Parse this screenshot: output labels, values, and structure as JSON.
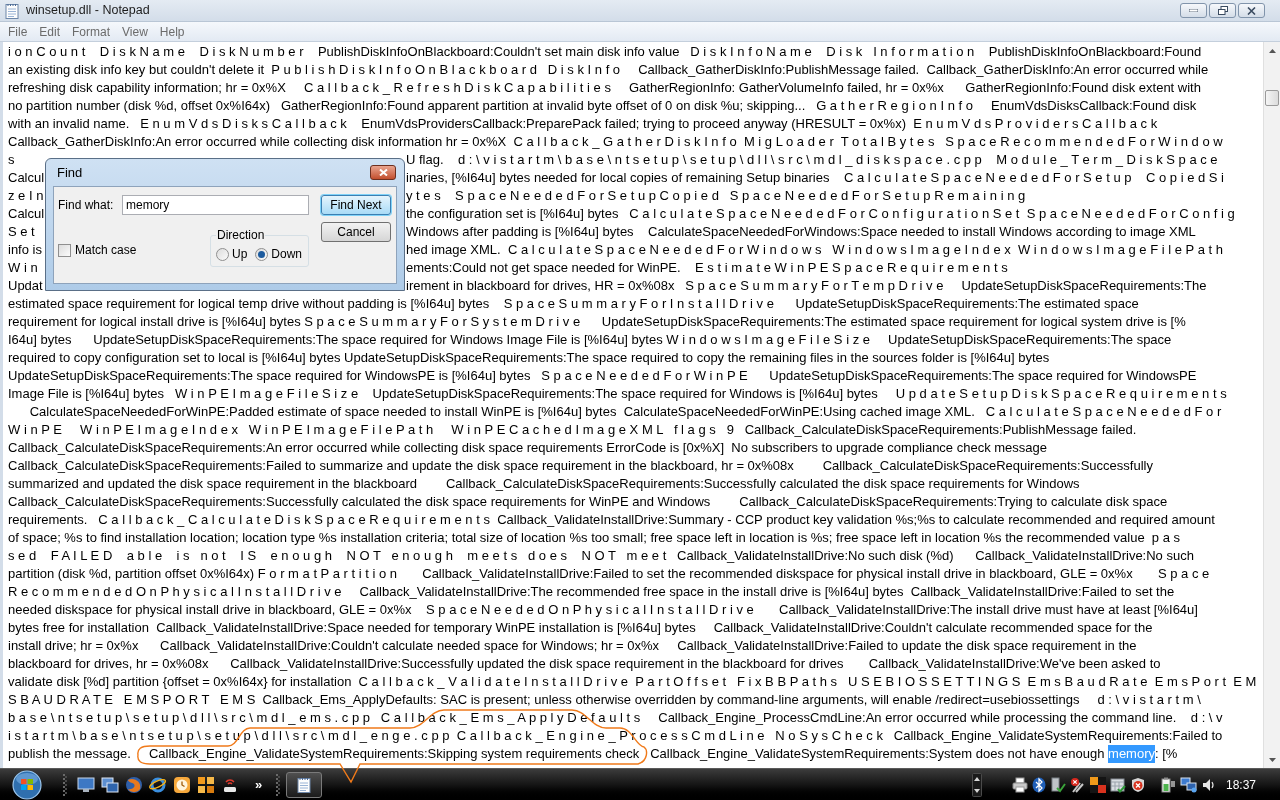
{
  "window": {
    "title": "winsetup.dll - Notepad",
    "menu": [
      "File",
      "Edit",
      "Format",
      "View",
      "Help"
    ]
  },
  "document": {
    "lines": [
      {
        "kind": "full",
        "text": "i o n C o u n t    D i s k N a m e    D i s k N u m b e r    PublishDiskInfoOnBlackboard:Couldn't set main disk info value   D i s k I n f o N a m e    D i s k   I n f o r m a t i o n    PublishDiskInfoOnBlackboard:Found"
      },
      {
        "kind": "full",
        "text": "an existing disk info key but couldn't delete it  P u b l i s h D i s k I n f o O n B l a c k b o a r d   D i s k I n f o     Callback_GatherDiskInfo:PublishMessage failed.  Callback_GatherDiskInfo:An error occurred while"
      },
      {
        "kind": "full",
        "text": "refreshing disk capability information; hr = 0x%X     C a l l b a c k _ R e f r e s h D i s k C a p a b i l i t i e s     GatherRegionInfo: GatherVolumeInfo failed, hr = 0x%x      GatherRegionInfo:Found disk extent with"
      },
      {
        "kind": "full",
        "text": "no partition number (disk %d, offset 0x%I64x)   GatherRegionInfo:Found apparent partition at invalid byte offset of 0 on disk %u; skipping...   G a t h e r R e g i o n I n f o     EnumVdsDisksCallback:Found disk"
      },
      {
        "kind": "full",
        "text": "with an invalid name.   E n u m V d s D i s k s C a l l b a c k    EnumVdsProvidersCallback:PreparePack failed; trying to proceed anyway (HRESULT = 0x%x)  E n u m V d s P r o v i d e r s C a l l b a c k"
      },
      {
        "kind": "full",
        "text": "Callback_GatherDiskInfo:An error occurred while collecting disk information hr = 0x%X  C a l l b a c k _ G a t h e r D i s k I n f o  M i g L o a d e r  T o t a l B y t e s   S p a c e R e c o m m e n d e d F o r W i n d o w"
      },
      {
        "kind": "split",
        "left": "s",
        "right": "U flag.    d : \\ v i s t a r t m \\ b a s e \\ n t s e t u p \\ s e t u p \\ d l l \\ s r c \\ m d l _ d i s k s p a c e . c p p    M o d u l e _ T e r m _ D i s k S p a c e"
      },
      {
        "kind": "split",
        "left": "Calcul",
        "right": "inaries, [%I64u] bytes needed for local copies of remaining Setup binaries    C a l c u l a t e S p a c e N e e d e d F o r S e t u p    C o p i e d S i"
      },
      {
        "kind": "split",
        "left": "z e I n",
        "right": "y t e s    S p a c e N e e d e d F o r S e t u p C o p i e d   S p a c e N e e d e d F o r S e t u p R e m a i n i n g"
      },
      {
        "kind": "split",
        "left": "Calcul",
        "right": "the configuration set is [%I64u] bytes   C a l c u l a t e S p a c e N e e d e d F o r C o n f i g u r a t i o n S e t  S p a c e N e e d e d F o r C o n f i g"
      },
      {
        "kind": "split",
        "left": "S e t",
        "right": "Windows after padding is [%I64u] bytes    CalculateSpaceNeededForWindows:Space needed to install Windows according to image XML"
      },
      {
        "kind": "split",
        "left": "info is",
        "right": "hed image XML.  C a l c u l a t e S p a c e N e e d e d F o r W i n d o w s   W i n d o w s I m a g e I n d e x  W i n d o w s I m a g e F i l e P a t h"
      },
      {
        "kind": "split",
        "left": "W i n",
        "right": "ements:Could not get space needed for WinPE.    E s t i m a t e W i n P E S p a c e R e q u i r e m e n t s"
      },
      {
        "kind": "split",
        "left": "Updat",
        "right": "irement in blackboard for drives, HR = 0x%08x   S p a c e S u m m a r y F o r T e m p D r i v e     UpdateSetupDiskSpaceRequirements:The"
      },
      {
        "kind": "full",
        "text": "estimated space requirement for logical temp drive without padding is [%I64u] bytes    S p a c e S u m m a r y F o r I n s t a l l D r i v e      UpdateSetupDiskSpaceRequirements:The estimated space"
      },
      {
        "kind": "full",
        "text": "requirement for logical install drive is [%I64u] bytes S p a c e S u m m a r y F o r S y s t e m D r i v e      UpdateSetupDiskSpaceRequirements:The estimated space requirement for logical system drive is [%"
      },
      {
        "kind": "full",
        "text": "I64u] bytes      UpdateSetupDiskSpaceRequirements:The space required for Windows Image File is [%I64u] bytes W i n d o w s I m a g e F i l e S i z e     UpdateSetupDiskSpaceRequirements:The space"
      },
      {
        "kind": "full",
        "text": "required to copy configuration set to local is [%I64u] bytes UpdateSetupDiskSpaceRequirements:The space required to copy the remaining files in the sources folder is [%I64u] bytes"
      },
      {
        "kind": "full",
        "text": "UpdateSetupDiskSpaceRequirements:The space required for WindowsPE is [%I64u] bytes   S p a c e N e e d e d F o r W i n P E      UpdateSetupDiskSpaceRequirements:The space required for WindowsPE"
      },
      {
        "kind": "full",
        "text": "Image File is [%I64u] bytes   W i n P E I m a g e F i l e S i z e    UpdateSetupDiskSpaceRequirements:The space required for Windows is [%I64u] bytes     U p d a t e S e t u p D i s k S p a c e R e q u i r e m e n t s"
      },
      {
        "kind": "full",
        "text": "      CalculateSpaceNeededForWinPE:Padded estimate of space needed to install WinPE is [%I64u] bytes  CalculateSpaceNeededForWinPE:Using cached image XML.   C a l c u l a t e S p a c e N e e d e d F o r"
      },
      {
        "kind": "full",
        "text": "W i n P E     W i n P E I m a g e I n d e x   W i n P E I m a g e F i l e P a t h     W i n P E C a c h e d I m a g e X M L   f l a g s   9   Callback_CalculateDiskSpaceRequirements:PublishMessage failed."
      },
      {
        "kind": "full",
        "text": "Callback_CalculateDiskSpaceRequirements:An error occurred while collecting disk space requirements ErrorCode is [0x%X]  No subscribers to upgrade compliance check message"
      },
      {
        "kind": "full",
        "text": "Callback_CalculateDiskSpaceRequirements:Failed to summarize and update the disk space requirement in the blackboard, hr = 0x%08x        Callback_CalculateDiskSpaceRequirements:Successfully"
      },
      {
        "kind": "full",
        "text": "summarized and updated the disk space requirement in the blackboard        Callback_CalculateDiskSpaceRequirements:Successfully calculated the disk space requirements for Windows"
      },
      {
        "kind": "full",
        "text": "Callback_CalculateDiskSpaceRequirements:Successfully calculated the disk space requirements for WinPE and Windows        Callback_CalculateDiskSpaceRequirements:Trying to calculate disk space"
      },
      {
        "kind": "full",
        "text": "requirements.   C a l l b a c k _ C a l c u l a t e D i s k S p a c e R e q u i r e m e n t s  Callback_ValidateInstallDrive:Summary - CCP product key validation %s;%s to calculate recommended and required amount"
      },
      {
        "kind": "full",
        "text": "of space; %s to find installation location; location type %s installation criteria; total size of location %s too small; free space left in location is %s; free space left in location %s the recommended value  p a s"
      },
      {
        "kind": "full",
        "text": "s e d    F A I L E D    a b l e    i s   n o t    I S    e n o u g h    N O T   e n o u g h    m e e t s   d o e s    N O T   m e e t   Callback_ValidateInstallDrive:No such disk (%d)      Callback_ValidateInstallDrive:No such"
      },
      {
        "kind": "full",
        "text": "partition (disk %d, partition offset 0x%I64x) F o r m a t P a r t i t i o n       Callback_ValidateInstallDrive:Failed to set the recommended diskspace for physical install drive in blackboard, GLE = 0x%x       S p a c e"
      },
      {
        "kind": "full",
        "text": "R e c o m m e n d e d O n P h y s i c a l I n s t a l l D r i v e     Callback_ValidateInstallDrive:The recommended free space in the install drive is [%I64u] bytes  Callback_ValidateInstallDrive:Failed to set the"
      },
      {
        "kind": "full",
        "text": "needed diskspace for physical install drive in blackboard, GLE = 0x%x    S p a c e N e e d e d O n P h y s i c a l I n s t a l l D r i v e       Callback_ValidateInstallDrive:The install drive must have at least [%I64u]"
      },
      {
        "kind": "full",
        "text": "bytes free for installation  Callback_ValidateInstallDrive:Space needed for temporary WinPE installation is [%I64u] bytes     Callback_ValidateInstallDrive:Couldn't calculate recommended space for the"
      },
      {
        "kind": "full",
        "text": "install drive; hr = 0x%x      Callback_ValidateInstallDrive:Couldn't calculate needed space for Windows; hr = 0x%x     Callback_ValidateInstallDrive:Failed to update the disk space requirement in the"
      },
      {
        "kind": "full",
        "text": "blackboard for drives, hr = 0x%08x      Callback_ValidateInstallDrive:Successfully updated the disk space requirement in the blackboard for drives       Callback_ValidateInstallDrive:We've been asked to"
      },
      {
        "kind": "full",
        "text": "validate disk [%d] partition {offset = 0x%I64x} for installation  C a l l b a c k _ V a l i d a t e I n s t a l l D r i v e  P a r t O f f s e t   F i x B B P a t h s   U S E B I O S S E T T I N G S  E m s B a u d R a t e  E m s P o r t  E M"
      },
      {
        "kind": "full",
        "text": "S B A U D R A T E   E M S P O R T   E M S  Callback_Ems_ApplyDefaults: SAC is present; unless otherwise overridden by command-line arguments, will enable /redirect=usebiossettings     d : \\ v i s t a r t m \\"
      },
      {
        "kind": "full",
        "text": "b a s e \\ n t s e t u p \\ s e t u p \\ d l l \\ s r c \\ m d l _ e m s . c p p   C a l l b a c k _ E m s _ A p p l y D e f a u l t s     Callback_Engine_ProcessCmdLine:An error occurred while processing the command line.    d : \\ v"
      },
      {
        "kind": "full",
        "text": "i s t a r t m \\ b a s e \\ n t s e t u p \\ s e t u p \\ d l l \\ s r c \\ m d l _ e n g e . c p p  C a l l b a c k _ E n g i n e _ P r o c e s s C m d L i n e   N o S y s C h e c k   Callback_Engine_ValidateSystemRequirements:Failed to"
      },
      {
        "kind": "parts",
        "parts": [
          {
            "text": "publish the message.     Callback_Engine_ValidateSystemRequirements:Skipping system requirements check   Callback_Engine_ValidateSystemRequirements:System does not have enough ",
            "selected": false
          },
          {
            "text": "memory",
            "selected": true
          },
          {
            "text": ": [%",
            "selected": false
          }
        ]
      }
    ]
  },
  "find_dialog": {
    "title": "Find",
    "find_what_label": "Find what:",
    "find_what_value": "memory",
    "buttons": [
      {
        "label": "Find Next",
        "focused": true
      },
      {
        "label": "Cancel",
        "focused": false
      }
    ],
    "match_case": {
      "label": "Match case",
      "checked": false
    },
    "direction": {
      "label": "Direction",
      "options": [
        {
          "label": "Up",
          "selected": false
        },
        {
          "label": "Down",
          "selected": true
        }
      ]
    }
  },
  "taskbar": {
    "overflow": "»",
    "clock": "18:37"
  }
}
